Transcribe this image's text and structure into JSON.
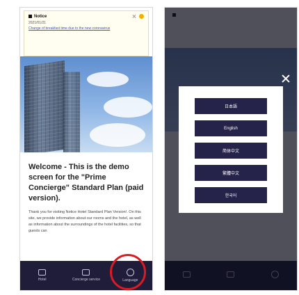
{
  "left_screen": {
    "notice": {
      "heading": "Notice",
      "date": "2021/01/21",
      "link_text": "Change of breakfast time due to the new coronavirus"
    },
    "welcome_title": "Welcome - This is the demo screen for the \"Prime Concierge\" Standard Plan (paid version).",
    "welcome_body": "Thank you for visiting Notice Hotel Standard Plan Version!. On this site, we provide information about our rooms and the hotel, as well as information about the surroundings of the hotel facilities, so that guests can",
    "tabs": [
      {
        "label": "Hotel",
        "icon": "home-icon"
      },
      {
        "label": "Concierge service",
        "icon": "concierge-bell-icon"
      },
      {
        "label": "Language",
        "icon": "language-icon"
      }
    ],
    "highlight_color": "#d81c22"
  },
  "right_screen": {
    "language_options": [
      "日本語",
      "English",
      "简体中文",
      "繁體中文",
      "한국어"
    ]
  },
  "colors": {
    "tabbar": "#1f1d3a",
    "button": "#25234a"
  }
}
